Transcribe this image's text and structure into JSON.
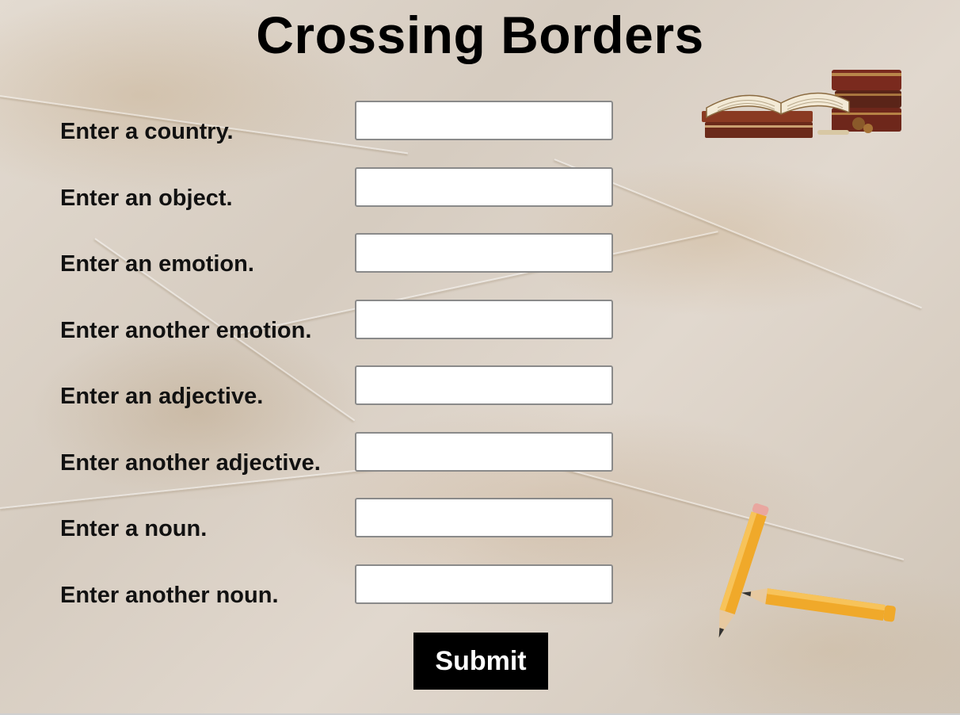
{
  "page": {
    "title": "Crossing Borders"
  },
  "form": {
    "fields": [
      {
        "label": "Enter a country.",
        "value": ""
      },
      {
        "label": "Enter an object.",
        "value": ""
      },
      {
        "label": "Enter an emotion.",
        "value": ""
      },
      {
        "label": "Enter another emotion.",
        "value": ""
      },
      {
        "label": "Enter an adjective.",
        "value": ""
      },
      {
        "label": "Enter another adjective.",
        "value": ""
      },
      {
        "label": "Enter a noun.",
        "value": ""
      },
      {
        "label": "Enter another noun.",
        "value": ""
      }
    ],
    "submit_label": "Submit"
  },
  "theme": {
    "background": "#dcd3c8",
    "button_bg": "#000000",
    "button_text": "#ffffff"
  },
  "decorations": {
    "books_icon": "books-icon",
    "pencils_icon": "pencils-icon"
  }
}
